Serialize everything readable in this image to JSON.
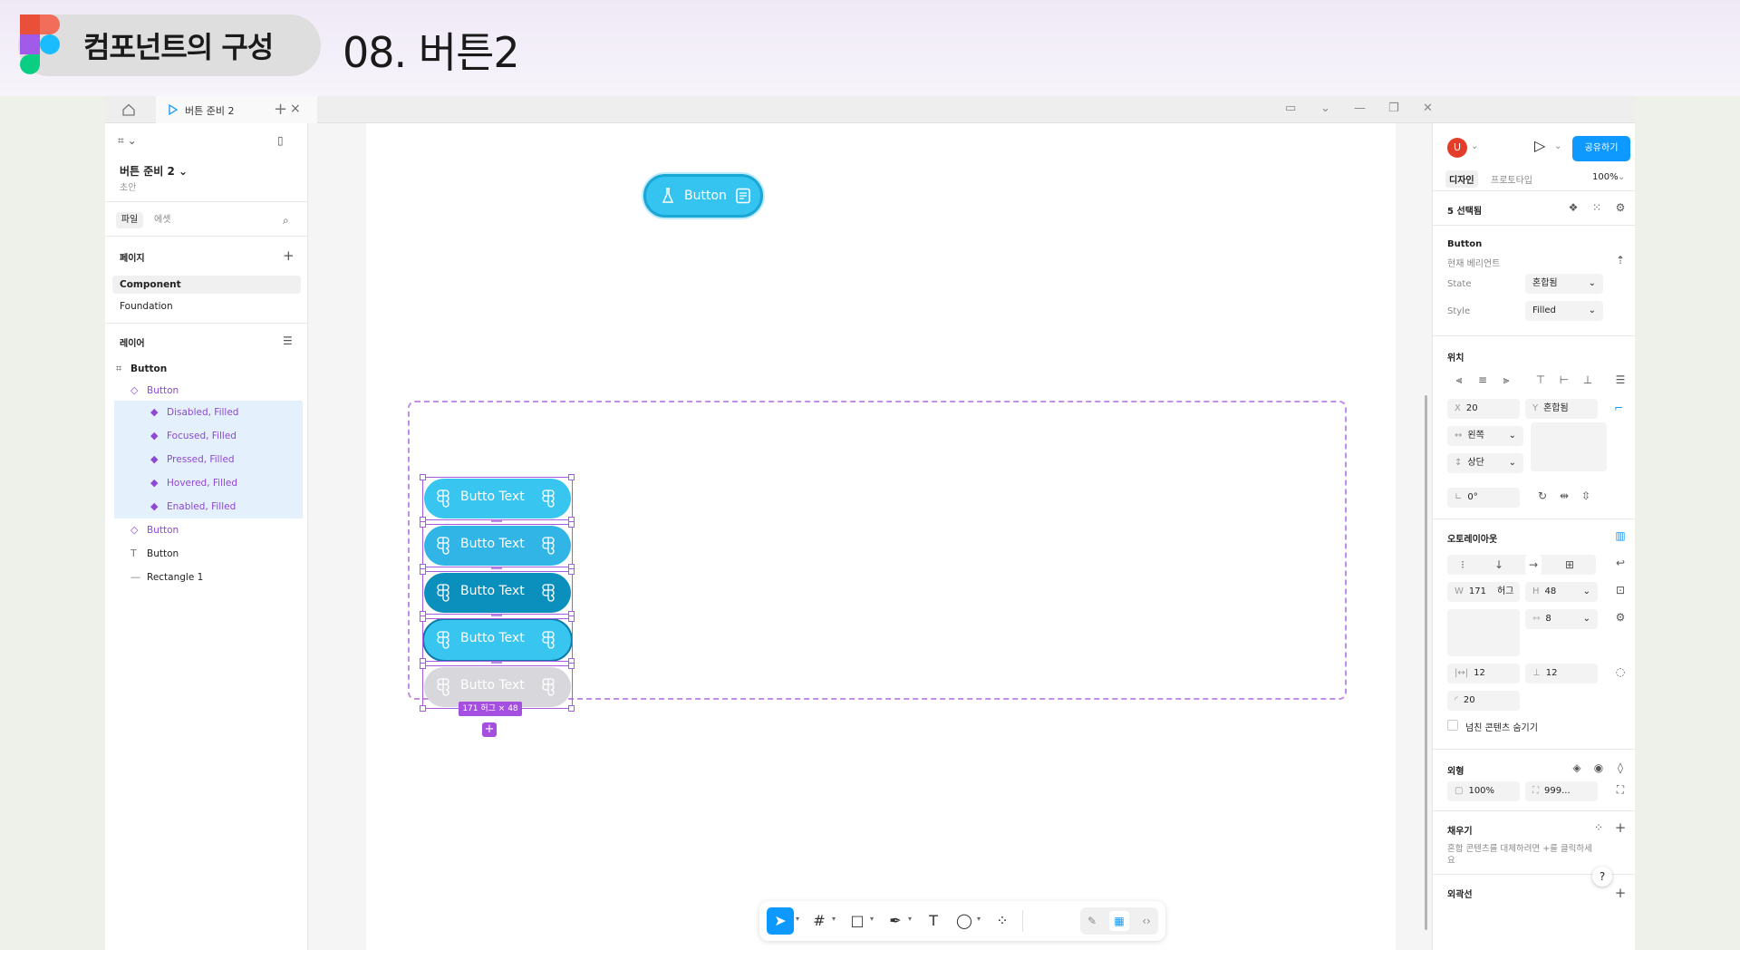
{
  "banner": {
    "pill_text": "컴포넌트의 구성",
    "title": "08. 버튼2"
  },
  "tabs": {
    "active_label": "버튼 준비 2",
    "close": "×",
    "add": "+"
  },
  "window_controls": [
    "▭",
    "⌄",
    "—",
    "❐",
    "✕"
  ],
  "left_panel": {
    "file_name": "버튼 준비 2",
    "file_sub": "초안",
    "seg_file": "파일",
    "seg_asset": "에셋",
    "pages_title": "페이지",
    "pages": [
      "Component",
      "Foundation"
    ],
    "layers_title": "레이어",
    "layers": [
      {
        "label": "Button",
        "glyph": "⌗"
      },
      {
        "label": "Button",
        "glyph": "◇"
      },
      {
        "label": "Disabled, Filled",
        "glyph": "◆"
      },
      {
        "label": "Focused, Filled",
        "glyph": "◆"
      },
      {
        "label": "Pressed, Filled",
        "glyph": "◆"
      },
      {
        "label": "Hovered, Filled",
        "glyph": "◆"
      },
      {
        "label": "Enabled, Filled",
        "glyph": "◆"
      },
      {
        "label": "Button",
        "glyph": "◇"
      },
      {
        "label": "Button",
        "glyph": "T"
      },
      {
        "label": "Rectangle 1",
        "glyph": "—"
      }
    ]
  },
  "canvas": {
    "single_button_label": "Button",
    "variant_label": "Butto Text",
    "size_tag": "171 허그 × 48",
    "add_badge": "+"
  },
  "right_panel": {
    "avatar": "U",
    "share": "공유하기",
    "tab_design": "디자인",
    "tab_prototype": "프로토타입",
    "zoom": "100%",
    "selection": "5 선택됨",
    "component_name": "Button",
    "current_variant": "현재 베리언트",
    "prop_state_label": "State",
    "prop_state_value": "혼합됨",
    "prop_style_label": "Style",
    "prop_style_value": "Filled",
    "position_title": "위치",
    "x_label": "X",
    "x_value": "20",
    "y_label": "Y",
    "y_value": "혼합됨",
    "h_constraint": "왼쪽",
    "v_constraint": "상단",
    "rotation": "0°",
    "autolayout_title": "오토레이아웃",
    "w_label": "W",
    "w_value": "171",
    "w_mode": "허그",
    "h_label": "H",
    "h_value": "48",
    "gap_value": "8",
    "pad_h": "12",
    "pad_v": "12",
    "radius_value": "20",
    "clip_label": "넘친 콘텐츠 숨기기",
    "appearance_title": "외형",
    "opacity": "100%",
    "corner": "999...",
    "fill_title": "채우기",
    "fill_hint": "혼합 콘텐츠를 대체하려면 +를 클릭하세요",
    "stroke_title": "외곽선",
    "help": "?"
  },
  "colors": {
    "button_blue": "#38c5ef",
    "pressed_blue": "#0b8fbd",
    "selection_purple": "#a55ae0",
    "share_blue": "#0d99ff"
  }
}
